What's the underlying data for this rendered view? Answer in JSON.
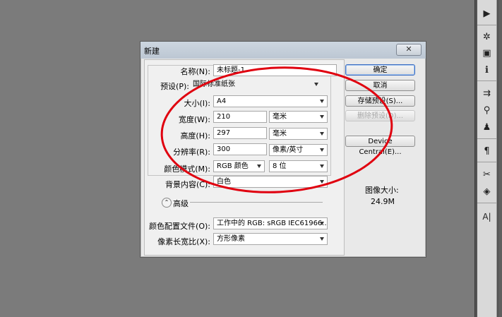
{
  "dialog": {
    "title": "新建",
    "close": "✕",
    "name_label": "名称(N):",
    "name_value": "未标题-1",
    "preset_label": "预设(P):",
    "preset_value": "国际标准纸张",
    "size_label": "大小(I):",
    "size_value": "A4",
    "width_label": "宽度(W):",
    "width_value": "210",
    "width_unit": "毫米",
    "height_label": "高度(H):",
    "height_value": "297",
    "height_unit": "毫米",
    "resolution_label": "分辨率(R):",
    "resolution_value": "300",
    "resolution_unit": "像素/英寸",
    "color_mode_label": "颜色模式(M):",
    "color_mode_value": "RGB 颜色",
    "bit_depth_value": "8 位",
    "background_label": "背景内容(C):",
    "background_value": "白色",
    "advanced_label": "高级",
    "advanced_icon": "⌃",
    "color_profile_label": "颜色配置文件(O):",
    "color_profile_value": "工作中的 RGB: sRGB IEC61966...",
    "pixel_aspect_label": "像素长宽比(X):",
    "pixel_aspect_value": "方形像素",
    "buttons": {
      "ok": "确定",
      "cancel": "取消",
      "save_preset": "存储预设(S)...",
      "delete_preset": "删除预设(D)...",
      "device_central": "Device Central(E)..."
    },
    "image_size_label": "图像大小:",
    "image_size_value": "24.9M"
  },
  "colors": {
    "annotation_oval": "#e0000f",
    "default_button_border": "#3e6ec1",
    "desktop": "#7b7b7b"
  },
  "tools": [
    "play-icon",
    "brush-settings-icon",
    "image-icon",
    "info-icon",
    "align-icon",
    "usb-icon",
    "stamp-icon",
    "paragraph-icon",
    "tools-icon",
    "3d-icon",
    "character-icon"
  ],
  "tool_glyphs": [
    "▶",
    "✲",
    "▣",
    "ℹ",
    "⇉",
    "⚲",
    "♟",
    "¶",
    "✂",
    "◈",
    "A|"
  ]
}
